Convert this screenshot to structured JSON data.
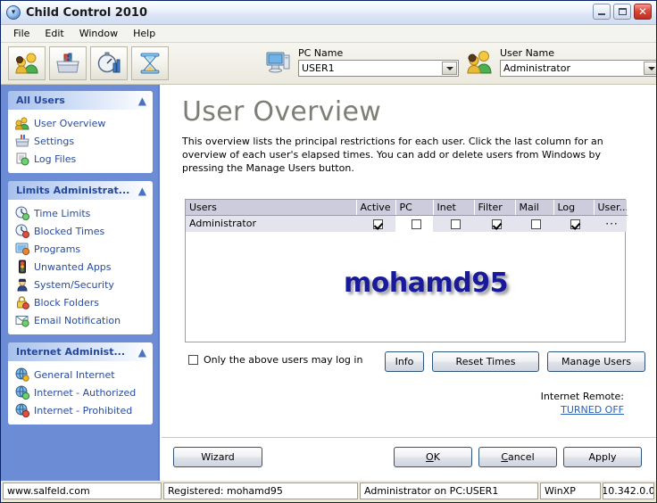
{
  "window": {
    "title": "Child Control 2010",
    "title_icon": "clock-icon",
    "buttons": {
      "minimize": "minimize-button",
      "maximize": "maximize-button",
      "close": "✕"
    }
  },
  "menu": {
    "items": [
      "File",
      "Edit",
      "Window",
      "Help"
    ]
  },
  "toolbar": {
    "buttons": [
      {
        "name": "users-toolbar-button",
        "icon": "users-group-icon"
      },
      {
        "name": "toolbox-toolbar-button",
        "icon": "toolbox-icon"
      },
      {
        "name": "stopwatch-toolbar-button",
        "icon": "stopwatch-chart-icon"
      },
      {
        "name": "hourglass-toolbar-button",
        "icon": "hourglass-icon"
      }
    ],
    "pc": {
      "label": "PC Name",
      "value": "USER1",
      "icon": "computer-icon"
    },
    "user": {
      "label": "User Name",
      "value": "Administrator",
      "icon": "users-group-icon"
    }
  },
  "sidebar": {
    "sections": [
      {
        "title": "All Users",
        "collapse_icon": "chevron-up-icon",
        "items": [
          {
            "label": "User Overview",
            "icon": "user-overview-icon"
          },
          {
            "label": "Settings",
            "icon": "settings-toolbox-icon"
          },
          {
            "label": "Log Files",
            "icon": "log-files-icon"
          }
        ]
      },
      {
        "title": "Limits Administrat...",
        "collapse_icon": "chevron-up-icon",
        "items": [
          {
            "label": "Time Limits",
            "icon": "clock-green-icon"
          },
          {
            "label": "Blocked Times",
            "icon": "clock-red-icon"
          },
          {
            "label": "Programs",
            "icon": "programs-icon"
          },
          {
            "label": "Unwanted Apps",
            "icon": "traffic-light-icon"
          },
          {
            "label": "System/Security",
            "icon": "policeman-icon"
          },
          {
            "label": "Block Folders",
            "icon": "lock-icon"
          },
          {
            "label": "Email Notification",
            "icon": "email-icon"
          }
        ]
      },
      {
        "title": "Internet Administ...",
        "collapse_icon": "chevron-up-icon",
        "items": [
          {
            "label": "General Internet",
            "icon": "globe-icon"
          },
          {
            "label": "Internet - Authorized",
            "icon": "globe-check-icon"
          },
          {
            "label": "Internet - Prohibited",
            "icon": "globe-block-icon"
          }
        ]
      }
    ]
  },
  "main": {
    "title": "User Overview",
    "description": "This overview lists the principal restrictions for each user. Click the last column for an overview of each user's elapsed times. You can add or delete users from Windows by pressing the Manage Users button.",
    "watermark": "mohamd95",
    "table": {
      "columns": [
        "Users",
        "Active",
        "PC",
        "Inet",
        "Filter",
        "Mail",
        "Log",
        "User..."
      ],
      "rows": [
        {
          "user": "Administrator",
          "active": true,
          "pc": false,
          "inet": false,
          "filter": true,
          "mail": false,
          "log": true,
          "more": "···"
        }
      ]
    },
    "only_above_users": {
      "label": "Only the above users may log in",
      "checked": false
    },
    "buttons": {
      "info": "Info",
      "reset_times": "Reset Times",
      "manage_users": "Manage Users"
    },
    "internet_remote": {
      "label": "Internet Remote:",
      "status": "TURNED OFF"
    }
  },
  "footer": {
    "wizard": "Wizard",
    "ok": "OK",
    "ok_accel": "O",
    "ok_rest": "K",
    "cancel_accel": "C",
    "cancel_rest": "ancel",
    "apply": "Apply"
  },
  "statusbar": {
    "website": "www.salfeld.com",
    "registered": "Registered: mohamd95",
    "context": "Administrator on PC:USER1",
    "os": "WinXP",
    "version": "10.342.0.0"
  },
  "colors": {
    "sidebar_bg": "#6d8cd6",
    "nav_text": "#274b9e",
    "section_title": "#24479c",
    "page_title": "#7e7e76",
    "watermark": "#19199c",
    "link": "#2b5fb5",
    "header_row": "#ccccdd"
  }
}
